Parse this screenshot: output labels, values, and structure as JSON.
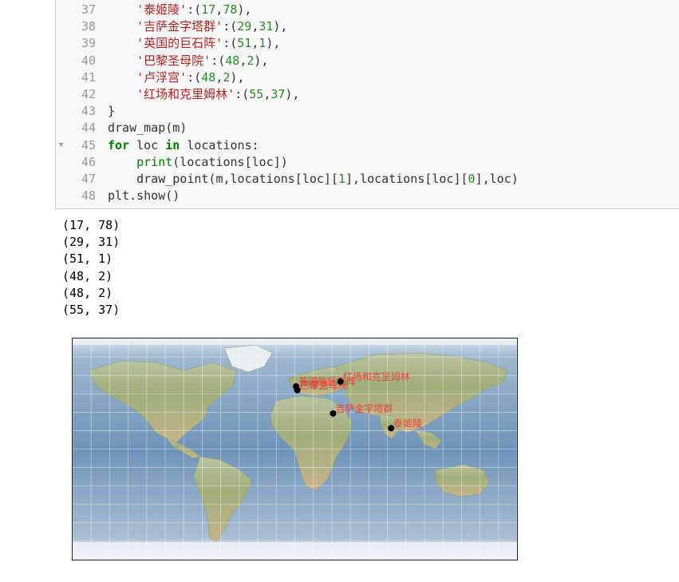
{
  "code_lines": [
    {
      "n": "37",
      "fold": "",
      "parts": [
        [
          "",
          "    "
        ],
        [
          "str",
          "'泰姬陵'"
        ],
        [
          "",
          ":("
        ],
        [
          "num",
          "17"
        ],
        [
          "",
          ","
        ],
        [
          "num",
          "78"
        ],
        [
          "",
          "),"
        ]
      ]
    },
    {
      "n": "38",
      "fold": "",
      "parts": [
        [
          "",
          "    "
        ],
        [
          "str",
          "'吉萨金字塔群'"
        ],
        [
          "",
          ":("
        ],
        [
          "num",
          "29"
        ],
        [
          "",
          ","
        ],
        [
          "num",
          "31"
        ],
        [
          "",
          "),"
        ]
      ]
    },
    {
      "n": "39",
      "fold": "",
      "parts": [
        [
          "",
          "    "
        ],
        [
          "str",
          "'英国的巨石阵'"
        ],
        [
          "",
          ":("
        ],
        [
          "num",
          "51"
        ],
        [
          "",
          ","
        ],
        [
          "num",
          "1"
        ],
        [
          "",
          "),"
        ]
      ]
    },
    {
      "n": "40",
      "fold": "",
      "parts": [
        [
          "",
          "    "
        ],
        [
          "str",
          "'巴黎圣母院'"
        ],
        [
          "",
          ":("
        ],
        [
          "num",
          "48"
        ],
        [
          "",
          ","
        ],
        [
          "num",
          "2"
        ],
        [
          "",
          "),"
        ]
      ]
    },
    {
      "n": "41",
      "fold": "",
      "parts": [
        [
          "",
          "    "
        ],
        [
          "str",
          "'卢浮宫'"
        ],
        [
          "",
          ":("
        ],
        [
          "num",
          "48"
        ],
        [
          "",
          ","
        ],
        [
          "num",
          "2"
        ],
        [
          "",
          "),"
        ]
      ]
    },
    {
      "n": "42",
      "fold": "",
      "parts": [
        [
          "",
          "    "
        ],
        [
          "str",
          "'红场和克里姆林'"
        ],
        [
          "",
          ":("
        ],
        [
          "num",
          "55"
        ],
        [
          "",
          ","
        ],
        [
          "num",
          "37"
        ],
        [
          "",
          "),"
        ]
      ]
    },
    {
      "n": "43",
      "fold": "",
      "parts": [
        [
          "",
          "}"
        ]
      ]
    },
    {
      "n": "44",
      "fold": "",
      "parts": [
        [
          "",
          "draw_map(m)"
        ]
      ]
    },
    {
      "n": "45",
      "fold": "▼",
      "parts": [
        [
          "kw",
          "for"
        ],
        [
          "",
          " loc "
        ],
        [
          "kw",
          "in"
        ],
        [
          "",
          " locations:"
        ]
      ]
    },
    {
      "n": "46",
      "fold": "",
      "parts": [
        [
          "",
          "    "
        ],
        [
          "bi",
          "print"
        ],
        [
          "",
          "(locations[loc])"
        ]
      ]
    },
    {
      "n": "47",
      "fold": "",
      "parts": [
        [
          "",
          "    draw_point(m,locations[loc]["
        ],
        [
          "num",
          "1"
        ],
        [
          "",
          "],locations[loc]["
        ],
        [
          "num",
          "0"
        ],
        [
          "",
          "],loc)"
        ]
      ]
    },
    {
      "n": "48",
      "fold": "",
      "parts": [
        [
          "",
          "plt.show()"
        ]
      ]
    }
  ],
  "output_lines": [
    "(17, 78)",
    "(29, 31)",
    "(51, 1)",
    "(48, 2)",
    "(48, 2)",
    "(55, 37)"
  ],
  "map": {
    "points": [
      {
        "name": "泰姬陵",
        "lat": 17,
        "lon": 78
      },
      {
        "name": "吉萨金字塔群",
        "lat": 29,
        "lon": 31
      },
      {
        "name": "英国的巨石阵",
        "lat": 51,
        "lon": 1
      },
      {
        "name": "巴黎圣母院",
        "lat": 48,
        "lon": 2
      },
      {
        "name": "卢浮宫",
        "lat": 48,
        "lon": 2
      },
      {
        "name": "红场和克里姆林",
        "lat": 55,
        "lon": 37
      }
    ],
    "label_color": "#e8443a",
    "marker_color": "#000000"
  }
}
